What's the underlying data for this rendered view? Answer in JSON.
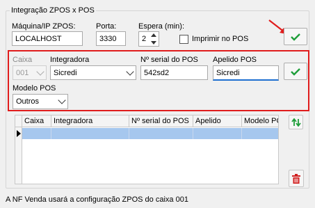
{
  "group": {
    "title": "Integração ZPOS x POS"
  },
  "top": {
    "machine_label": "Máquina/IP ZPOS:",
    "machine_value": "LOCALHOST",
    "port_label": "Porta:",
    "port_value": "3330",
    "wait_label": "Espera (min):",
    "wait_value": "2",
    "print_label": "Imprimir no POS",
    "print_checked": false
  },
  "edit": {
    "caixa_label": "Caixa",
    "caixa_value": "001",
    "integradora_label": "Integradora",
    "integradora_value": "Sicredi",
    "serial_label": "Nº serial do POS",
    "serial_value": "542sd2",
    "apelido_label": "Apelido POS",
    "apelido_value": "Sicredi",
    "modelo_label": "Modelo POS",
    "modelo_value": "Outros"
  },
  "grid": {
    "columns": [
      "Caixa",
      "Integradora",
      "Nº serial do POS",
      "Apelido",
      "Modelo PC"
    ],
    "rows": [
      [
        "",
        "",
        "",
        "",
        ""
      ]
    ]
  },
  "footer": {
    "text": "A NF Venda usará a configuração ZPOS do caixa 001"
  },
  "colors": {
    "accent_green": "#1e9e3a",
    "highlight_red": "#e01c1c",
    "selection": "#a6c7ee",
    "delete_red": "#d11f1f"
  }
}
